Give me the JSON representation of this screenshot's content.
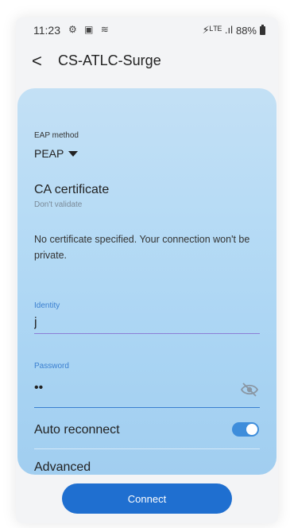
{
  "status": {
    "time": "11:23",
    "left_icons": "⚙ ▣ ≋",
    "right_icons": "⚡ᴸᵀᴱ .ıl",
    "battery": "88%"
  },
  "header": {
    "back_icon": "chevron-left-icon",
    "title": "CS-ATLC-Surge"
  },
  "form": {
    "eap_label": "EAP method",
    "eap_value": "PEAP",
    "ca_title": "CA certificate",
    "ca_sub": "Don't validate",
    "warning": "No certificate specified. Your connection won't be private.",
    "identity_label": "Identity",
    "identity_value": "j",
    "password_label": "Password",
    "password_value": "••",
    "auto_reconnect_label": "Auto reconnect",
    "auto_reconnect_on": true,
    "advanced_label": "Advanced"
  },
  "actions": {
    "connect_label": "Connect"
  },
  "colors": {
    "accent": "#1f6fd0",
    "field_label": "#3a7fd0"
  }
}
